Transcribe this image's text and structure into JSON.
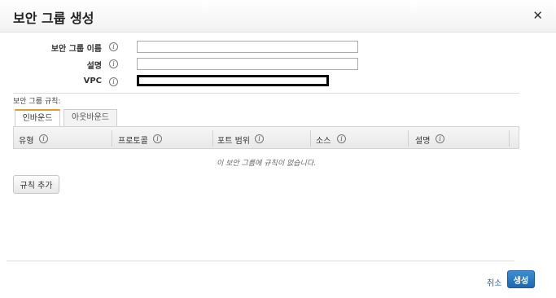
{
  "dialog": {
    "title": "보안 그룹 생성",
    "close_symbol": "✕"
  },
  "form": {
    "name_label": "보안 그룹 이름",
    "name_value": "",
    "description_label": "설명",
    "description_value": "",
    "vpc_label": "VPC",
    "info_symbol": "i"
  },
  "rules": {
    "section_label": "보안 그룹 규칙:",
    "tabs": [
      {
        "label": "인바운드",
        "active": true
      },
      {
        "label": "아웃바운드",
        "active": false
      }
    ],
    "columns": [
      "유형",
      "프로토콜",
      "포트 범위",
      "소스",
      "설명"
    ],
    "empty_message": "이 보안 그룹에 규칙이 없습니다.",
    "add_rule_label": "규칙 추가"
  },
  "footer": {
    "cancel_label": "취소",
    "create_label": "생성"
  },
  "colors": {
    "primary": "#1f68b1",
    "active_tab_accent": "#e39c27",
    "link": "#1e66b0"
  }
}
